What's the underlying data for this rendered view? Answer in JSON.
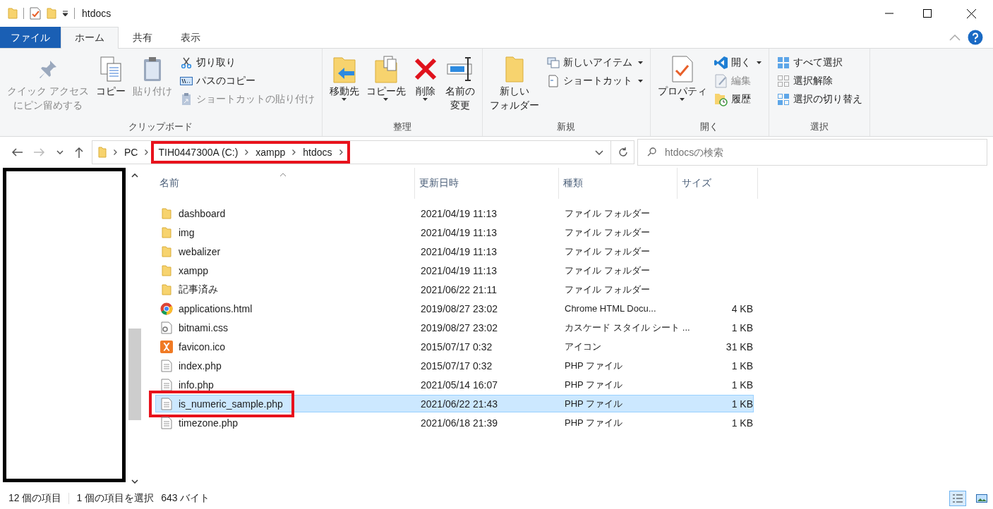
{
  "window": {
    "title": "htdocs"
  },
  "tabs": [
    {
      "label": "ファイル",
      "kind": "file",
      "selected": false
    },
    {
      "label": "ホーム",
      "kind": "tab",
      "selected": true
    },
    {
      "label": "共有",
      "kind": "tab",
      "selected": false
    },
    {
      "label": "表示",
      "kind": "tab",
      "selected": false
    }
  ],
  "ribbon": {
    "groups": [
      {
        "label": "クリップボード",
        "items": [
          {
            "kind": "large",
            "lines": [
              "クイック アクセス",
              "にピン留めする"
            ],
            "disabled": true,
            "dropdown": false
          },
          {
            "kind": "large",
            "lines": [
              "コピー"
            ],
            "disabled": false,
            "dropdown": false
          },
          {
            "kind": "large",
            "lines": [
              "貼り付け"
            ],
            "disabled": true,
            "dropdown": false
          },
          {
            "kind": "stack",
            "items": [
              {
                "label": "切り取り",
                "disabled": false,
                "dropdown": false
              },
              {
                "label": "パスのコピー",
                "disabled": false,
                "dropdown": false
              },
              {
                "label": "ショートカットの貼り付け",
                "disabled": true,
                "dropdown": false
              }
            ]
          }
        ]
      },
      {
        "label": "整理",
        "items": [
          {
            "kind": "large",
            "lines": [
              "移動先"
            ],
            "disabled": false,
            "dropdown": true
          },
          {
            "kind": "large",
            "lines": [
              "コピー先"
            ],
            "disabled": false,
            "dropdown": true
          },
          {
            "kind": "large",
            "lines": [
              "削除"
            ],
            "disabled": false,
            "dropdown": true
          },
          {
            "kind": "large",
            "lines": [
              "名前の",
              "変更"
            ],
            "disabled": false,
            "dropdown": false
          }
        ]
      },
      {
        "label": "新規",
        "items": [
          {
            "kind": "large",
            "lines": [
              "新しい",
              "フォルダー"
            ],
            "disabled": false,
            "dropdown": false
          },
          {
            "kind": "stack",
            "items": [
              {
                "label": "新しいアイテム",
                "disabled": false,
                "dropdown": true
              },
              {
                "label": "ショートカット",
                "disabled": false,
                "dropdown": true
              }
            ]
          }
        ]
      },
      {
        "label": "開く",
        "items": [
          {
            "kind": "large",
            "lines": [
              "プロパティ"
            ],
            "disabled": false,
            "dropdown": true
          },
          {
            "kind": "stack",
            "items": [
              {
                "label": "開く",
                "disabled": false,
                "dropdown": true
              },
              {
                "label": "編集",
                "disabled": true,
                "dropdown": false
              },
              {
                "label": "履歴",
                "disabled": false,
                "dropdown": false
              }
            ]
          }
        ]
      },
      {
        "label": "選択",
        "items": [
          {
            "kind": "stack",
            "items": [
              {
                "label": "すべて選択",
                "disabled": false,
                "dropdown": false
              },
              {
                "label": "選択解除",
                "disabled": false,
                "dropdown": false
              },
              {
                "label": "選択の切り替え",
                "disabled": false,
                "dropdown": false
              }
            ]
          }
        ]
      }
    ]
  },
  "address": {
    "crumbs": [
      {
        "label": "PC",
        "annotated": false
      },
      {
        "label": "TIH0447300A (C:)",
        "annotated": true
      },
      {
        "label": "xampp",
        "annotated": true
      },
      {
        "label": "htdocs",
        "annotated": true
      }
    ]
  },
  "search": {
    "placeholder": "htdocsの検索"
  },
  "table": {
    "columns": [
      "名前",
      "更新日時",
      "種類",
      "サイズ"
    ],
    "rows": [
      {
        "kind": "folder",
        "name": "dashboard",
        "modified": "2021/04/19 11:13",
        "type": "ファイル フォルダー",
        "size": "",
        "selected": false,
        "annotated": false
      },
      {
        "kind": "folder",
        "name": "img",
        "modified": "2021/04/19 11:13",
        "type": "ファイル フォルダー",
        "size": "",
        "selected": false,
        "annotated": false
      },
      {
        "kind": "folder",
        "name": "webalizer",
        "modified": "2021/04/19 11:13",
        "type": "ファイル フォルダー",
        "size": "",
        "selected": false,
        "annotated": false
      },
      {
        "kind": "folder",
        "name": "xampp",
        "modified": "2021/04/19 11:13",
        "type": "ファイル フォルダー",
        "size": "",
        "selected": false,
        "annotated": false
      },
      {
        "kind": "folder",
        "name": "記事済み",
        "modified": "2021/06/22 21:11",
        "type": "ファイル フォルダー",
        "size": "",
        "selected": false,
        "annotated": false
      },
      {
        "kind": "chrome",
        "name": "applications.html",
        "modified": "2019/08/27 23:02",
        "type": "Chrome HTML Docu...",
        "size": "4 KB",
        "selected": false,
        "annotated": false
      },
      {
        "kind": "css",
        "name": "bitnami.css",
        "modified": "2019/08/27 23:02",
        "type": "カスケード スタイル シート ...",
        "size": "1 KB",
        "selected": false,
        "annotated": false
      },
      {
        "kind": "xampp",
        "name": "favicon.ico",
        "modified": "2015/07/17 0:32",
        "type": "アイコン",
        "size": "31 KB",
        "selected": false,
        "annotated": false
      },
      {
        "kind": "file",
        "name": "index.php",
        "modified": "2015/07/17 0:32",
        "type": "PHP ファイル",
        "size": "1 KB",
        "selected": false,
        "annotated": false
      },
      {
        "kind": "file",
        "name": "info.php",
        "modified": "2021/05/14 16:07",
        "type": "PHP ファイル",
        "size": "1 KB",
        "selected": false,
        "annotated": false
      },
      {
        "kind": "file",
        "name": "is_numeric_sample.php",
        "modified": "2021/06/22 21:43",
        "type": "PHP ファイル",
        "size": "1 KB",
        "selected": true,
        "annotated": true
      },
      {
        "kind": "file",
        "name": "timezone.php",
        "modified": "2021/06/18 21:39",
        "type": "PHP ファイル",
        "size": "1 KB",
        "selected": false,
        "annotated": false
      }
    ]
  },
  "status_bar": {
    "item_count": "12 個の項目",
    "selection": "1 個の項目を選択",
    "selection_size": "643 バイト",
    "views": [
      {
        "kind": "details",
        "selected": true
      },
      {
        "kind": "large",
        "selected": false
      }
    ]
  }
}
